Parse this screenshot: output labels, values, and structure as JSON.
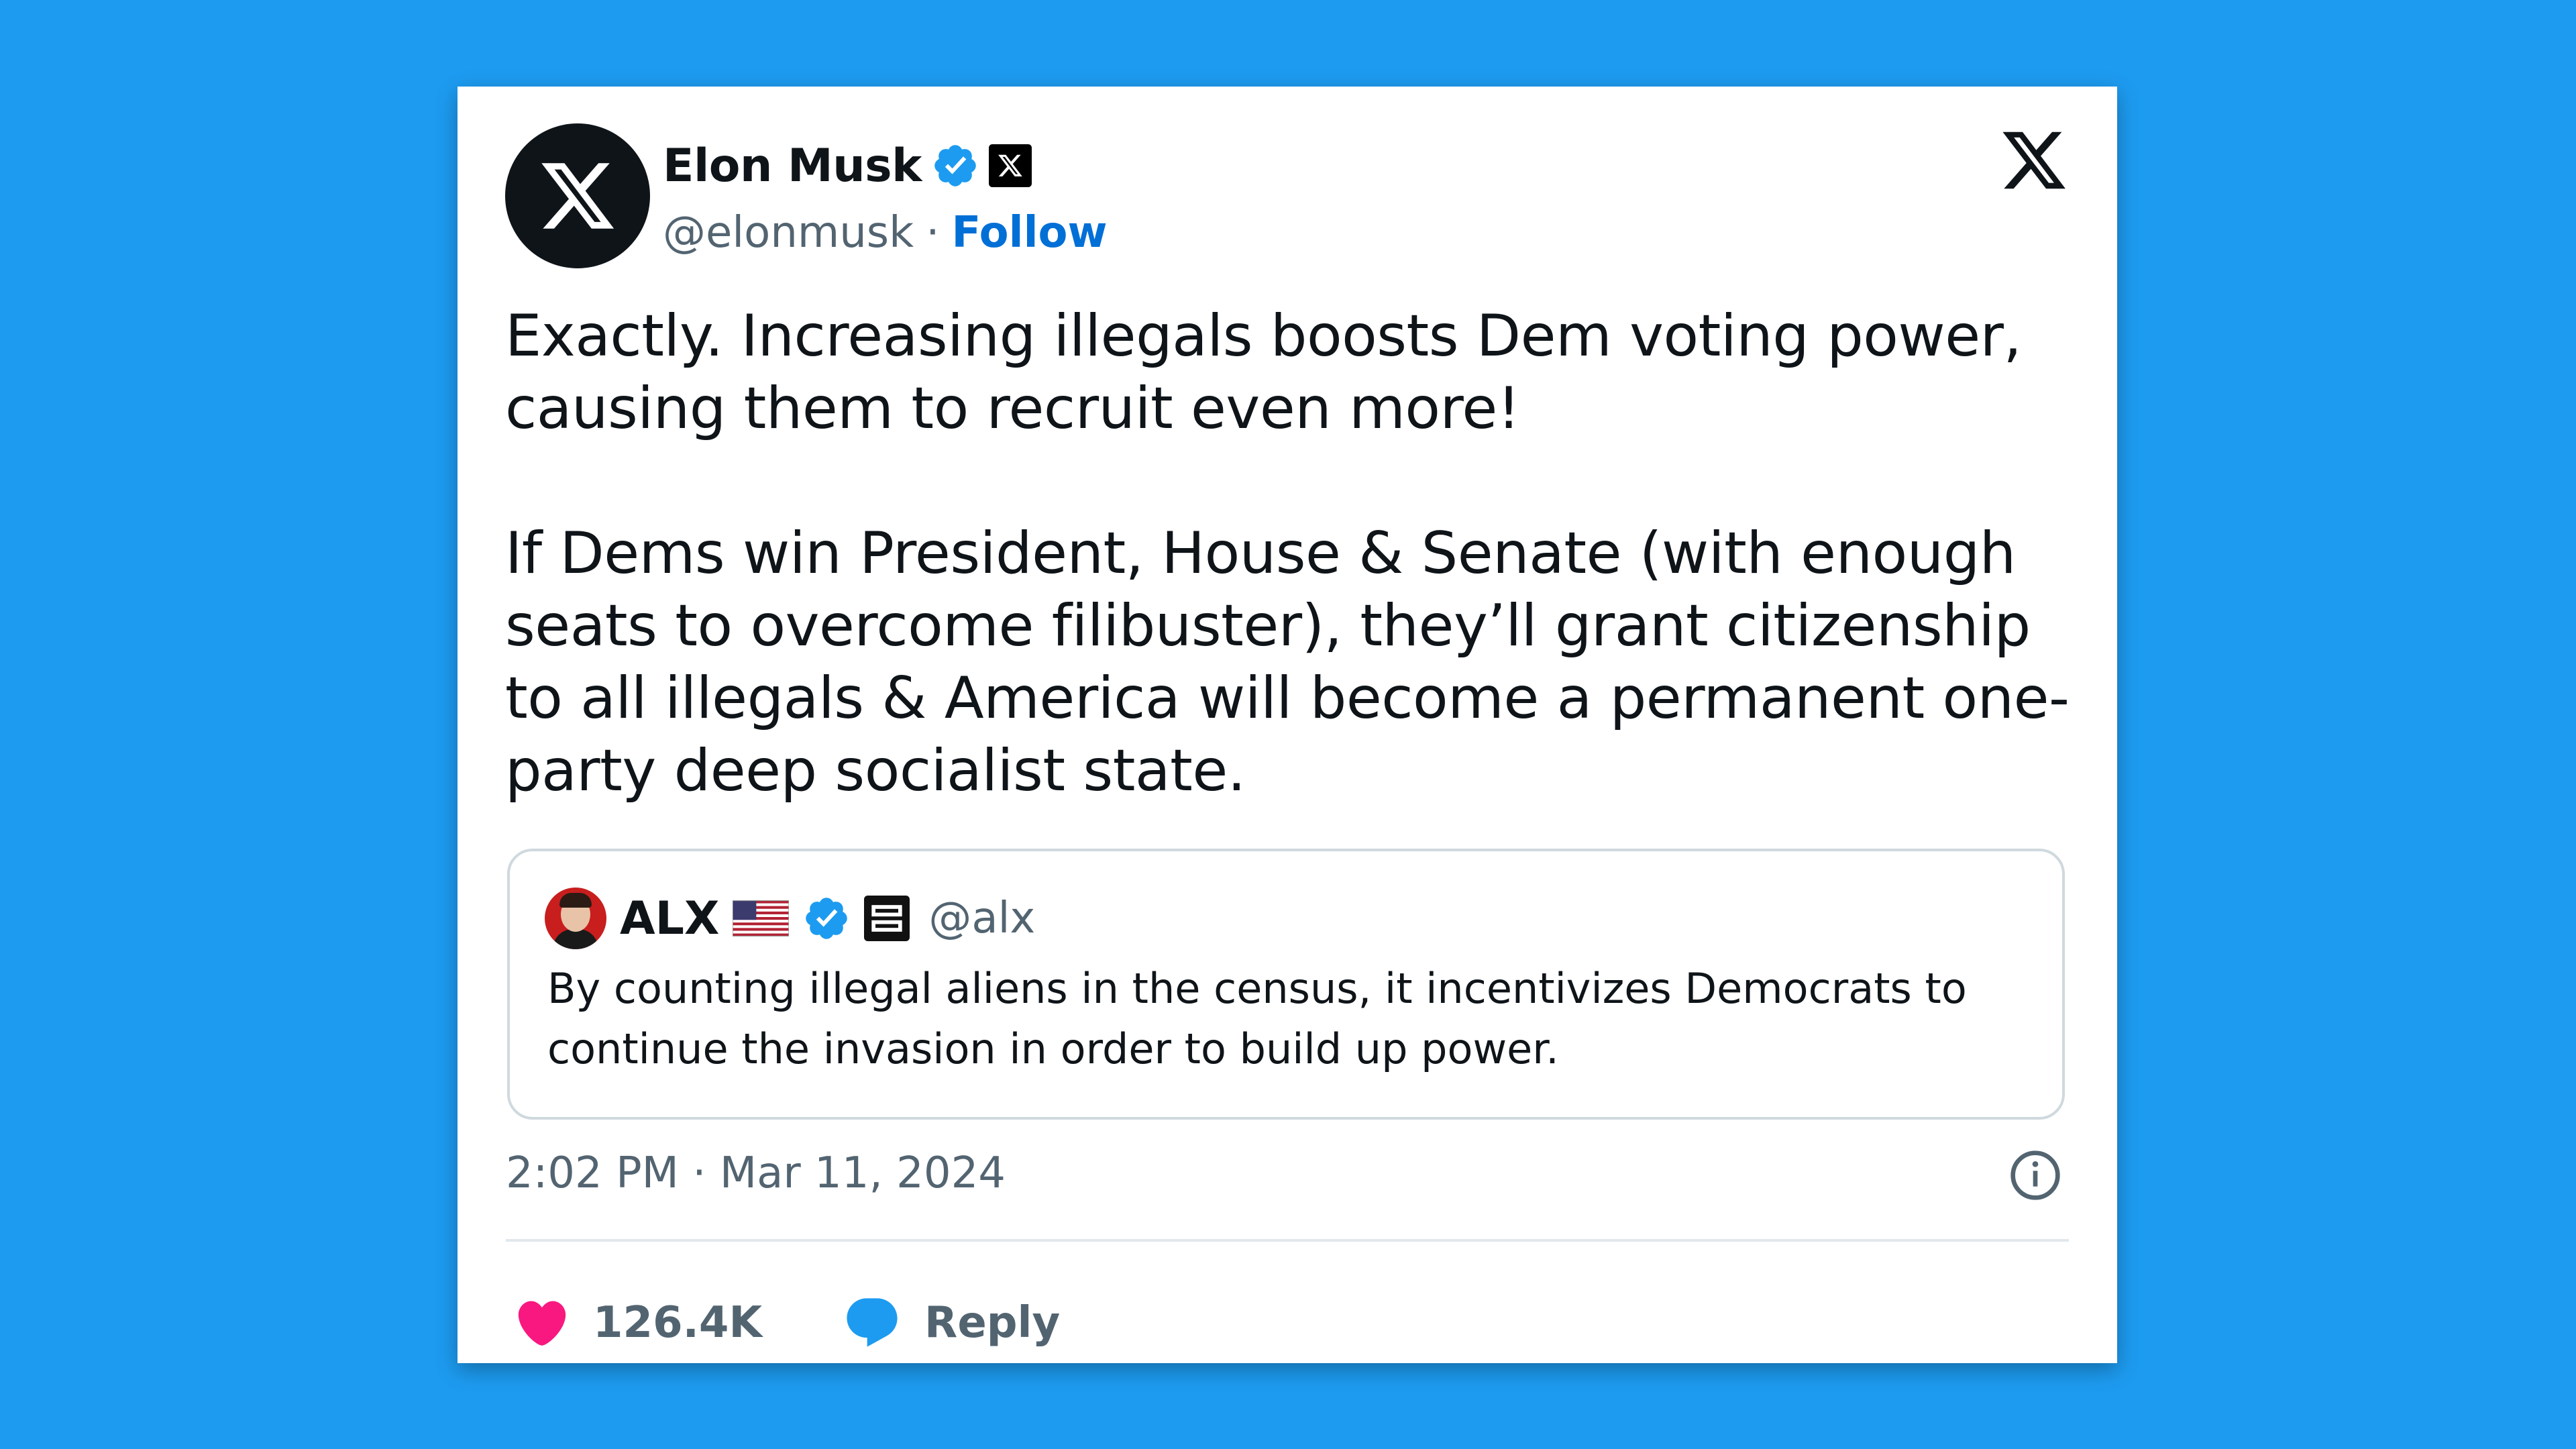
{
  "tweet": {
    "author": {
      "name": "Elon Musk",
      "handle": "@elonmusk",
      "separator": "·",
      "follow_label": "Follow"
    },
    "text": "Exactly. Increasing illegals boosts Dem voting power, causing them to recruit even more!\n\nIf Dems win President, House & Senate (with enough seats to overcome filibuster), they’ll grant citizenship to all illegals & America will become a permanent one-party deep socialist state.",
    "quoted": {
      "name": "ALX",
      "handle": "@alx",
      "text": "By counting illegal aliens in the census, it incentivizes Democrats to continue the invasion in order to build up power."
    },
    "timestamp": "2:02 PM · Mar 11, 2024",
    "likes": "126.4K",
    "reply_label": "Reply"
  },
  "colors": {
    "background": "#1d9bf0",
    "verified": "#1d9bf0",
    "follow": "#006fd6",
    "like": "#f91880",
    "reply": "#1d9bf0"
  },
  "icons": [
    "x-logo-icon",
    "verified-badge-icon",
    "us-flag-icon",
    "info-icon",
    "heart-icon",
    "reply-bubble-icon"
  ]
}
